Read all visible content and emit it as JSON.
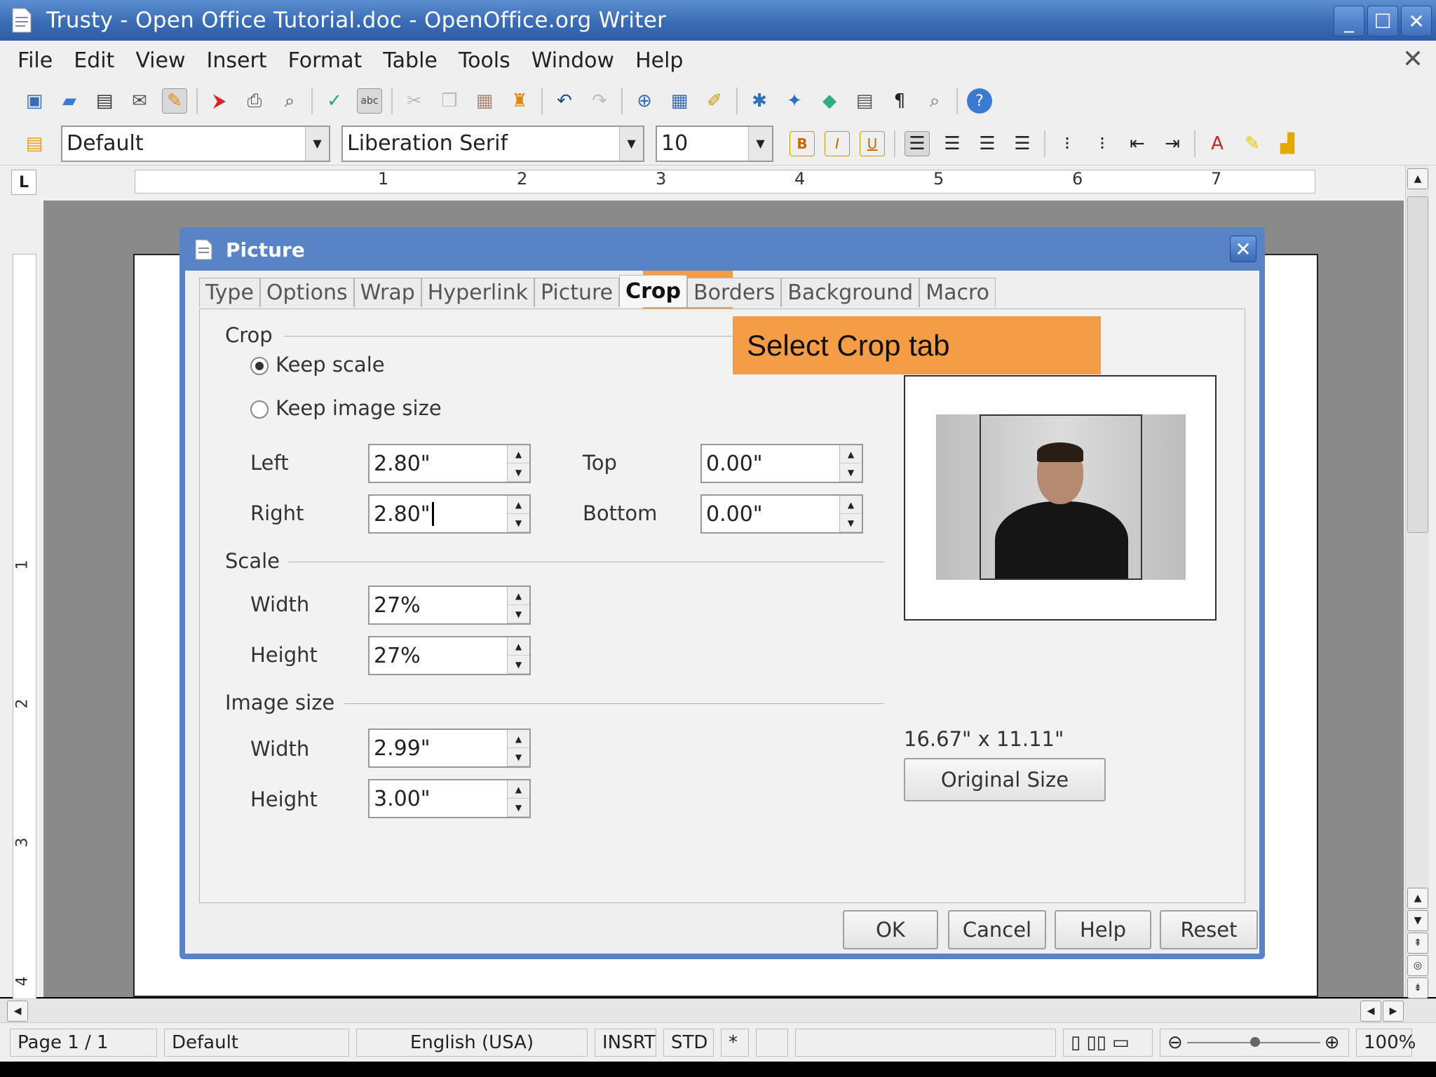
{
  "window": {
    "title": "Trusty - Open Office Tutorial.doc - OpenOffice.org Writer",
    "min": "_",
    "max": "☐",
    "close": "✕"
  },
  "menubar": {
    "items": [
      {
        "label": "File"
      },
      {
        "label": "Edit"
      },
      {
        "label": "View"
      },
      {
        "label": "Insert"
      },
      {
        "label": "Format"
      },
      {
        "label": "Table"
      },
      {
        "label": "Tools"
      },
      {
        "label": "Window"
      },
      {
        "label": "Help"
      }
    ],
    "close_doc": "✕"
  },
  "formatting": {
    "style": "Default",
    "font": "Liberation Serif",
    "size": "10",
    "bold": "B",
    "italic": "I",
    "underline": "U"
  },
  "ruler": {
    "corner": "L",
    "numbers": [
      "1",
      "2",
      "3",
      "4",
      "5",
      "6",
      "7"
    ],
    "v_numbers": [
      "1",
      "2",
      "3",
      "4"
    ]
  },
  "dialog": {
    "title": "Picture",
    "close": "✕",
    "tabs": [
      {
        "label": "Type"
      },
      {
        "label": "Options"
      },
      {
        "label": "Wrap"
      },
      {
        "label": "Hyperlink"
      },
      {
        "label": "Picture"
      },
      {
        "label": "Crop"
      },
      {
        "label": "Borders"
      },
      {
        "label": "Background"
      },
      {
        "label": "Macro"
      }
    ],
    "crop": {
      "section": "Crop",
      "keep_scale": "Keep scale",
      "keep_image_size": "Keep image size",
      "left_label": "Left",
      "left_value": "2.80\"",
      "right_label": "Right",
      "right_value": "2.80\"",
      "top_label": "Top",
      "top_value": "0.00\"",
      "bottom_label": "Bottom",
      "bottom_value": "0.00\""
    },
    "scale": {
      "section": "Scale",
      "width_label": "Width",
      "width_value": "27%",
      "height_label": "Height",
      "height_value": "27%"
    },
    "image_size": {
      "section": "Image size",
      "width_label": "Width",
      "width_value": "2.99\"",
      "height_label": "Height",
      "height_value": "3.00\""
    },
    "original_dims": "16.67\" x 11.11\"",
    "original_size_button": "Original Size",
    "buttons": {
      "ok": "OK",
      "cancel": "Cancel",
      "help": "Help",
      "reset": "Reset"
    }
  },
  "callout": "Select Crop tab",
  "statusbar": {
    "page": "Page 1 / 1",
    "style": "Default",
    "language": "English (USA)",
    "insert_mode": "INSRT",
    "selection_mode": "STD",
    "modified": "*",
    "zoom": "100%"
  },
  "colors": {
    "titlebar": "#3a6cb6",
    "highlight": "#f59c46"
  }
}
